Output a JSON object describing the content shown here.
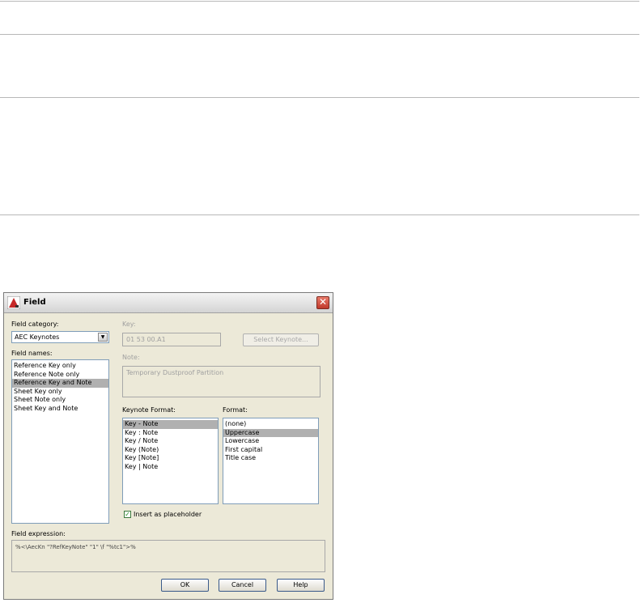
{
  "dialog": {
    "title": "Field",
    "close_glyph": "✕",
    "field_category_label": "Field category:",
    "field_category_value": "AEC Keynotes",
    "field_names_label": "Field names:",
    "field_names": [
      "Reference Key only",
      "Reference Note only",
      "Reference Key and Note",
      "Sheet Key only",
      "Sheet Note only",
      "Sheet Key and Note"
    ],
    "field_names_selected": 2,
    "key_label": "Key:",
    "key_value": "01 53 00.A1",
    "select_keynote_button": "Select Keynote...",
    "note_label": "Note:",
    "note_value": "Temporary Dustproof Partition",
    "keynote_format_label": "Keynote Format:",
    "keynote_formats": [
      "Key - Note",
      "Key : Note",
      "Key / Note",
      "Key (Note)",
      "Key [Note]",
      "Key | Note"
    ],
    "keynote_format_selected": 0,
    "format_label": "Format:",
    "formats": [
      "(none)",
      "Uppercase",
      "Lowercase",
      "First capital",
      "Title case"
    ],
    "format_selected": 1,
    "insert_placeholder_label": "Insert as placeholder",
    "insert_placeholder_checked": true,
    "field_expression_label": "Field expression:",
    "field_expression_value": "%<\\AecKn \"?RefKeyNote\" \"1\" \\f \"%tc1\">%",
    "ok_button": "OK",
    "cancel_button": "Cancel",
    "help_button": "Help"
  },
  "colors": {
    "dialog_bg": "#ece9d8",
    "selection": "#b0b0b0",
    "disabled_text": "#a0a0a0",
    "close_button": "#c0392b"
  }
}
